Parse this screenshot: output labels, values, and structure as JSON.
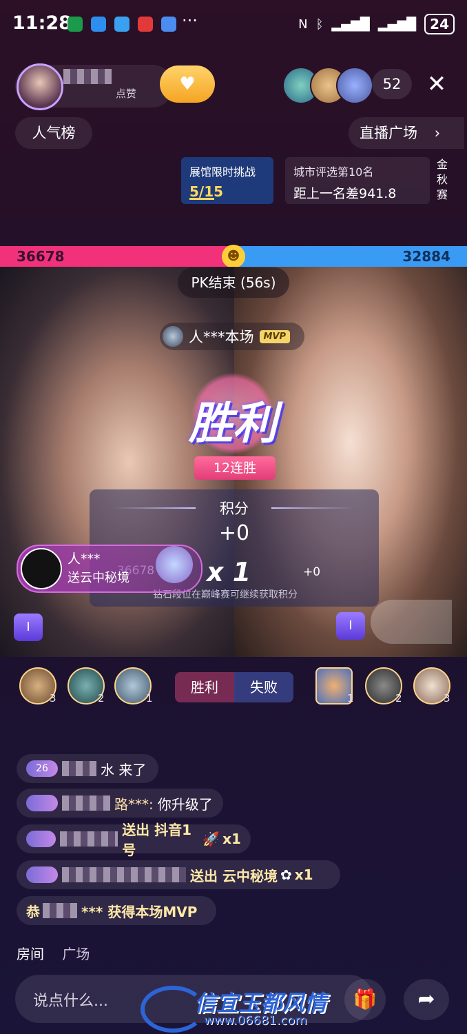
{
  "status_bar": {
    "time": "11:28",
    "more": "···",
    "battery": "24"
  },
  "header": {
    "like_suffix": "点赞",
    "viewer_count": "52",
    "close_label": "✕",
    "popularity_label": "人气榜",
    "live_square_label": "直播广场",
    "challenge": {
      "title": "展馆限时挑战",
      "progress": "5/15"
    },
    "city_rank": {
      "title": "城市评选第10名",
      "gap": "距上一名差941.8"
    },
    "autumn_tag": "金秋赛"
  },
  "pk": {
    "left_score": "36678",
    "right_score": "32884",
    "end_label": "PK结束 (56s)",
    "mvp_name": "人***本场",
    "mvp_tag": "MVP",
    "win_logo": "胜利",
    "streak": "12连胜",
    "score_title": "积分",
    "score_value": "+0",
    "left_small_score": "36678",
    "multiplier": "x 1",
    "right_plus": "+0",
    "note": "钻石段位在巅峰赛可继续获取积分",
    "gift_user": "人***",
    "gift_text": "送云中秘境",
    "badge_left": "I",
    "badge_right": "I"
  },
  "contributors": {
    "left": [
      {
        "rank": "3"
      },
      {
        "rank": "2"
      },
      {
        "rank": "1"
      }
    ],
    "right": [
      {
        "rank": "1"
      },
      {
        "rank": "2"
      },
      {
        "rank": "3"
      }
    ],
    "win_label": "胜利",
    "lose_label": "失败"
  },
  "chat": [
    {
      "level": "26",
      "text": "水 来了"
    },
    {
      "level": "",
      "name": "路***:",
      "text": "你升级了"
    },
    {
      "level": "",
      "text": "送出 抖音1号",
      "suffix": "x1"
    },
    {
      "level": "",
      "text": "送出 云中秘境",
      "suffix": "x1"
    },
    {
      "prefix": "恭",
      "text": "*** 获得本场MVP"
    }
  ],
  "tabs": {
    "room": "房间",
    "square": "广场"
  },
  "input": {
    "placeholder": "说点什么..."
  },
  "watermark": {
    "text": "信宜玉都风情",
    "url": "www.06681.com"
  },
  "colors": {
    "pk_left": "#f2317b",
    "pk_right": "#3a9bf4",
    "accent": "#ffd75e"
  }
}
